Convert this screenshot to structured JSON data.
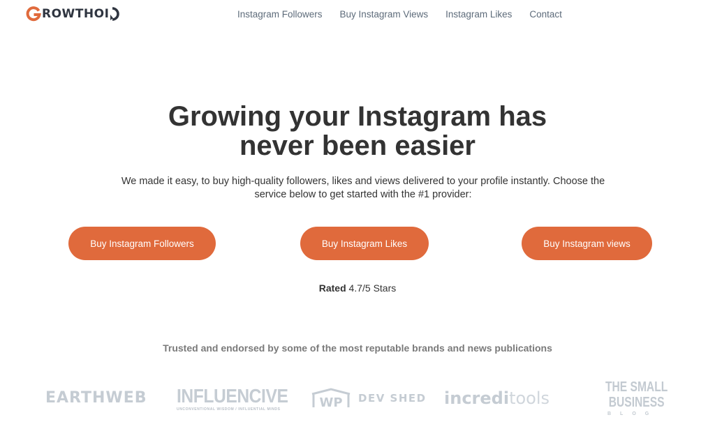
{
  "header": {
    "logo_text": "ROWTHOI",
    "logo_full": "GROWTHOID",
    "nav": [
      {
        "label": "Instagram Followers"
      },
      {
        "label": "Buy Instagram Views"
      },
      {
        "label": "Instagram Likes"
      },
      {
        "label": "Contact"
      }
    ]
  },
  "hero": {
    "title_line1": "Growing your Instagram has",
    "title_line2": "never been easier",
    "subtitle": "We made it easy, to buy high-quality followers, likes and views delivered to your profile instantly. Choose the service below to get started with the #1 provider:"
  },
  "cta_buttons": [
    {
      "label": "Buy Instagram Followers"
    },
    {
      "label": "Buy Instagram Likes"
    },
    {
      "label": "Buy Instagram views"
    }
  ],
  "rating": {
    "prefix": "Rated",
    "value": "4.7/5 Stars"
  },
  "trusted": {
    "heading": "Trusted and endorsed by some of the most reputable brands and news publications",
    "brands": [
      {
        "name": "EARTHWEB"
      },
      {
        "name": "INFLUENCIVE",
        "tagline": "UNCONVENTIONAL WISDOM / INFLUENTIAL MINDS"
      },
      {
        "name": "DEV SHED",
        "mark": "WP"
      },
      {
        "name_bold": "incredi",
        "name_thin": "tools"
      },
      {
        "line1": "THE SMALL",
        "line2": "BUSINESS",
        "line3": "BLOG"
      }
    ]
  },
  "colors": {
    "accent": "#e06a3c",
    "text_dark": "#333333",
    "nav_text": "#5d6b7a",
    "muted": "#7a7a7a",
    "brand_gray": "#c5ccd3"
  }
}
